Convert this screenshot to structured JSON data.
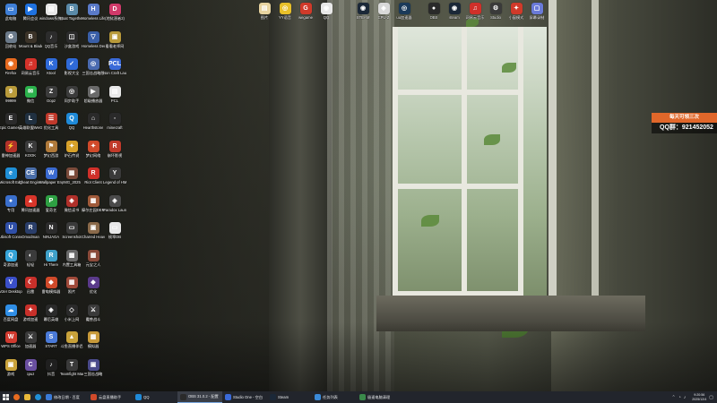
{
  "overlay": {
    "top_text": "每天可领三次",
    "qq_text": "QQ群：921452052"
  },
  "icons_col1": [
    {
      "label": "此电脑",
      "color": "#3f7fd6",
      "glyph": "▭"
    },
    {
      "label": "回收站",
      "color": "#6b7a8a",
      "glyph": "♻"
    },
    {
      "label": "Firefox",
      "color": "#e66a1f",
      "glyph": "◉"
    },
    {
      "label": "99999",
      "color": "#b89a3a",
      "glyph": "9"
    },
    {
      "label": "Epic Games Launcher",
      "color": "#2b2b2b",
      "glyph": "E"
    },
    {
      "label": "雷神加速器",
      "color": "#b3322a",
      "glyph": "⚡"
    },
    {
      "label": "Microsoft Edge",
      "color": "#1f8fd6",
      "glyph": "e"
    },
    {
      "label": "专用",
      "color": "#3a6fcc",
      "glyph": "●"
    },
    {
      "label": "Ubisoft Connect",
      "color": "#2f4fa8",
      "glyph": "U"
    },
    {
      "label": "奇游加速",
      "color": "#35a3d8",
      "glyph": "Q"
    },
    {
      "label": "V2er Desktop",
      "color": "#3a4fc8",
      "glyph": "V"
    },
    {
      "label": "百度网盘",
      "color": "#2f8ee6",
      "glyph": "☁"
    },
    {
      "label": "WPS Office",
      "color": "#d03a2f",
      "glyph": "W"
    },
    {
      "label": "游戏",
      "color": "#c9a23a",
      "glyph": "▣"
    }
  ],
  "icons_col2": [
    {
      "label": "腾讯会议",
      "color": "#1f72e0",
      "glyph": "▶"
    },
    {
      "label": "Mount & Blade II",
      "color": "#3b3328",
      "glyph": "B"
    },
    {
      "label": "网易云音乐",
      "color": "#d4322a",
      "glyph": "♫"
    },
    {
      "label": "微信",
      "color": "#2bb24c",
      "glyph": "✉"
    },
    {
      "label": "英雄联盟WeGame",
      "color": "#203040",
      "glyph": "L"
    },
    {
      "label": "KOOK",
      "color": "#3b3b3b",
      "glyph": "K"
    },
    {
      "label": "Cheat Engine.exe",
      "color": "#4a6ea8",
      "glyph": "CE"
    },
    {
      "label": "腾讯加速器",
      "color": "#d8352a",
      "glyph": "▲"
    },
    {
      "label": "Omodman",
      "color": "#2a3e6a",
      "glyph": "R"
    },
    {
      "label": "轻轻",
      "color": "#3b3b3b",
      "glyph": "◐"
    },
    {
      "label": "迅雷",
      "color": "#c8302a",
      "glyph": "☾"
    },
    {
      "label": "游戏加速",
      "color": "#c8302a",
      "glyph": "✦"
    },
    {
      "label": "加速器",
      "color": "#3a3a3a",
      "glyph": "⚔"
    },
    {
      "label": "cpuz",
      "color": "#6a4fa0",
      "glyph": "C"
    }
  ],
  "icons_col3": [
    {
      "label": "windows系统激活",
      "color": "#e8e8e8",
      "glyph": "▤"
    },
    {
      "label": "QQ音乐",
      "color": "#2c2c2c",
      "glyph": "♪"
    },
    {
      "label": "Ktool",
      "color": "#2f6ad8",
      "glyph": "K"
    },
    {
      "label": "Oopz",
      "color": "#3b3b3b",
      "glyph": "Z"
    },
    {
      "label": "优化工具",
      "color": "#c0392b",
      "glyph": "☰"
    },
    {
      "label": "梦幻西游",
      "color": "#b07a3a",
      "glyph": "⚑"
    },
    {
      "label": "Wallpaper Engine",
      "color": "#3a6ad0",
      "glyph": "W"
    },
    {
      "label": "爱奇艺",
      "color": "#2ea043",
      "glyph": "P"
    },
    {
      "label": "NINJAGA",
      "color": "#2c2c2c",
      "glyph": "N"
    },
    {
      "label": "Hi There",
      "color": "#3fa0c8",
      "glyph": "R"
    },
    {
      "label": "雷电模拟器",
      "color": "#d04a2a",
      "glyph": "◆"
    },
    {
      "label": "幕后英雄",
      "color": "#2a2a2a",
      "glyph": "◈"
    },
    {
      "label": "START",
      "color": "#4a7ad8",
      "glyph": "S"
    },
    {
      "label": "抖音",
      "color": "#1f1f1f",
      "glyph": "♪"
    }
  ],
  "icons_col4": [
    {
      "label": "Boat Together",
      "color": "#5a8aa8",
      "glyph": "B"
    },
    {
      "label": "沙盒游戏",
      "color": "#2b2b2b",
      "glyph": "◫"
    },
    {
      "label": "影视大全",
      "color": "#2f6ad8",
      "glyph": "✓"
    },
    {
      "label": "同步助手",
      "color": "#3b3b3b",
      "glyph": "◎"
    },
    {
      "label": "QQ",
      "color": "#1f8ad8",
      "glyph": "Q"
    },
    {
      "label": "炉石传说",
      "color": "#d8a22a",
      "glyph": "✦"
    },
    {
      "label": "IMG_2025",
      "color": "#7a4a3a",
      "glyph": "▦"
    },
    {
      "label": "微信读书",
      "color": "#b0302a",
      "glyph": "◈"
    },
    {
      "label": "Screenshot",
      "color": "#3a3a3a",
      "glyph": "▭"
    },
    {
      "label": "内置工具箱",
      "color": "#6a6a6a",
      "glyph": "▩"
    },
    {
      "label": "照片",
      "color": "#a04a3a",
      "glyph": "▦"
    },
    {
      "label": "小米上网",
      "color": "#2a2a2a",
      "glyph": "◇"
    },
    {
      "label": "斗鱼直播伴侣",
      "color": "#c8a23a",
      "glyph": "▲"
    },
    {
      "label": "Teamfight Manager",
      "color": "#3a3a3a",
      "glyph": "T"
    }
  ],
  "icons_col5": [
    {
      "label": "Homeless Life Sim",
      "color": "#5a7ac8",
      "glyph": "H"
    },
    {
      "label": "Homeless Demo",
      "color": "#3a5fa8",
      "glyph": "▽"
    },
    {
      "label": "三国志战略版",
      "color": "#4a6ab0",
      "glyph": "◎"
    },
    {
      "label": "超级播放器",
      "color": "#6a6a6a",
      "glyph": "▶"
    },
    {
      "label": "Hearthstone",
      "color": "#2a2a2a",
      "glyph": "⌂"
    },
    {
      "label": "梦幻网络",
      "color": "#d04a2a",
      "glyph": "✦"
    },
    {
      "label": "Riot Client",
      "color": "#d0302a",
      "glyph": "R"
    },
    {
      "label": "摩尔庄园DEMO",
      "color": "#a05a3a",
      "glyph": "▩"
    },
    {
      "label": "Charred Heaven",
      "color": "#8a6a4a",
      "glyph": "▣"
    },
    {
      "label": "元宝之人",
      "color": "#8a4a3a",
      "glyph": "▦"
    },
    {
      "label": "优化",
      "color": "#5a3a8a",
      "glyph": "◆"
    },
    {
      "label": "魔兽战斗",
      "color": "#3a3a3a",
      "glyph": "⚔"
    },
    {
      "label": "模拟器",
      "color": "#c89a3a",
      "glyph": "▦"
    },
    {
      "label": "三国志战略",
      "color": "#4a4a8a",
      "glyph": "▣"
    }
  ],
  "icons_col6": [
    {
      "label": "(地狱潜者2)",
      "color": "#d03a6a",
      "glyph": "D"
    },
    {
      "label": "看看老师网",
      "color": "#b89a3a",
      "glyph": "▣"
    },
    {
      "label": "Non Craft Launcher 2",
      "color": "#3a6ad8",
      "glyph": "PCL"
    },
    {
      "label": "PCL",
      "color": "#e8e8e8",
      "glyph": "▤"
    },
    {
      "label": "minecraft",
      "color": "#2a2a2a",
      "glyph": "◦"
    },
    {
      "label": "崩坏影视",
      "color": "#c03a2a",
      "glyph": "R"
    },
    {
      "label": "Legend of HMM",
      "color": "#3a3a3a",
      "glyph": "Y"
    },
    {
      "label": "Paradox Launcher",
      "color": "#4a4a4a",
      "glyph": "◈"
    },
    {
      "label": "帧率DB",
      "color": "#e8e8e8",
      "glyph": "▭"
    },
    {
      "label": "",
      "color": "#000000",
      "glyph": ""
    },
    {
      "label": "",
      "color": "#000000",
      "glyph": ""
    },
    {
      "label": "",
      "color": "#000000",
      "glyph": ""
    },
    {
      "label": "",
      "color": "#000000",
      "glyph": ""
    },
    {
      "label": "",
      "color": "#000000",
      "glyph": ""
    }
  ],
  "icons_top": [
    {
      "label": "图片",
      "color": "#e8d4a0",
      "glyph": "▤"
    },
    {
      "label": "YY语音",
      "color": "#e8c02a",
      "glyph": "◎"
    },
    {
      "label": "wegame",
      "color": "#d03a2a",
      "glyph": "G"
    },
    {
      "label": "QQ",
      "color": "#e8e8e8",
      "glyph": "◉"
    },
    {
      "label": "STEAM",
      "color": "#1b2838",
      "glyph": "◉"
    },
    {
      "label": "CPU-Z",
      "color": "#d8d8d8",
      "glyph": "◈"
    },
    {
      "label": "uu加速器",
      "color": "#1b3a5a",
      "glyph": "◎"
    },
    {
      "label": "OBS",
      "color": "#2a2a2a",
      "glyph": "●"
    },
    {
      "label": "steam",
      "color": "#1b2838",
      "glyph": "◉"
    },
    {
      "label": "网易云音乐",
      "color": "#d0302a",
      "glyph": "♫"
    },
    {
      "label": "Studio",
      "color": "#3a3a3a",
      "glyph": "⚙"
    },
    {
      "label": "小窗模式",
      "color": "#d03a2a",
      "glyph": "✦"
    },
    {
      "label": "屏幕录制",
      "color": "#6a7ad8",
      "glyph": "▢"
    }
  ],
  "taskbar": {
    "apps": [
      {
        "label": "修改日期 - 百度",
        "active": false,
        "color": "#3a7ad8"
      },
      {
        "label": "云盘直播助手",
        "active": false,
        "color": "#d04a2a"
      },
      {
        "label": "QQ",
        "active": false,
        "color": "#1f8ad8"
      },
      {
        "label": "OBS 31.0.2 - 配置",
        "active": true,
        "color": "#2a2a2a"
      },
      {
        "label": "Studio One - 空白",
        "active": false,
        "color": "#3a6ad8"
      },
      {
        "label": "Steam",
        "active": false,
        "color": "#1b2838"
      },
      {
        "label": "任务列表",
        "active": false,
        "color": "#3a8ad8"
      },
      {
        "label": "极速电脑清理",
        "active": false,
        "color": "#3a8a4a"
      }
    ],
    "time": "9:20:56",
    "date": "2025/12/4"
  }
}
